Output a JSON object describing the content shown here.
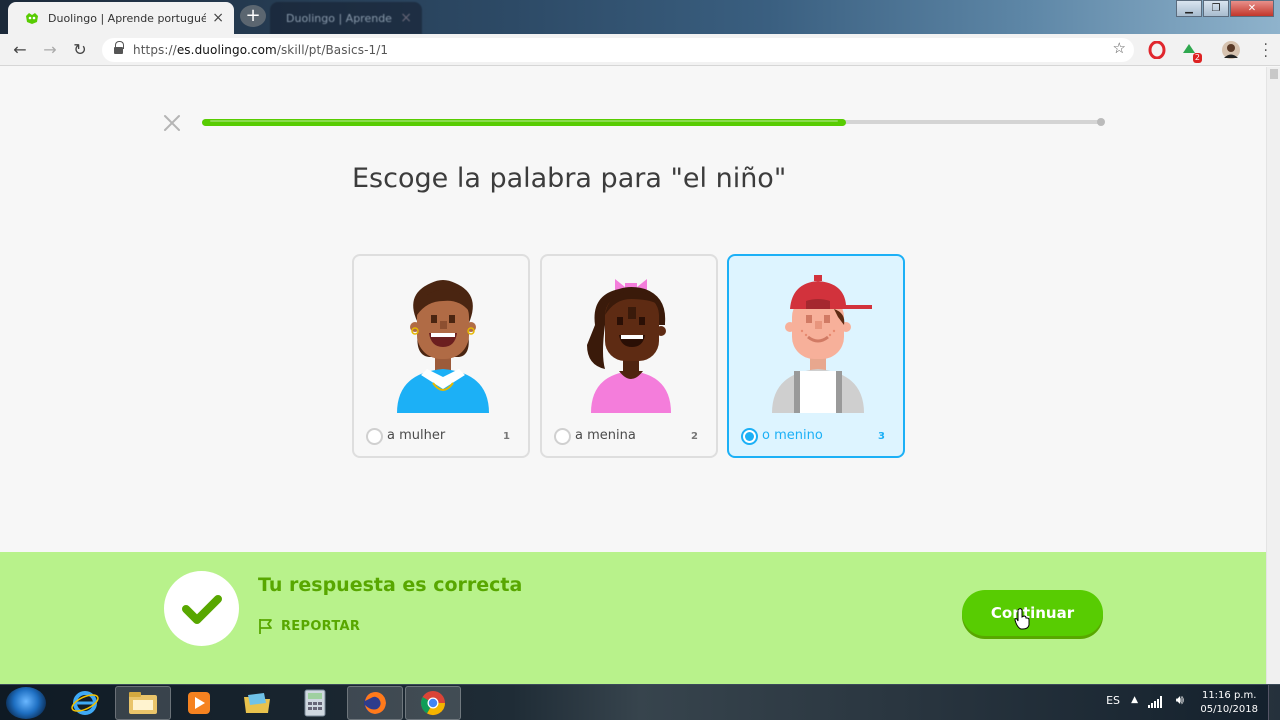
{
  "browser": {
    "tabs": [
      {
        "title": "Duolingo | Aprende portugués c",
        "close": "×"
      },
      {
        "title": "Duolingo | Aprende portugués c",
        "close": "×"
      }
    ],
    "new_tab": "+",
    "window_buttons": {
      "minimize": "▁",
      "maximize": "❐",
      "close": "✕"
    },
    "url_prefix": "https://",
    "url_host": "es.duolingo.com",
    "url_path": "/skill/pt/Basics-1/1",
    "bookmark_icon": "star-icon",
    "extension_badge": "2"
  },
  "lesson": {
    "progress_fraction": 0.715,
    "prompt": "Escoge la palabra para \"el niño\"",
    "choices": [
      {
        "label": "a mulher",
        "key": "1",
        "selected": false
      },
      {
        "label": "a menina",
        "key": "2",
        "selected": false
      },
      {
        "label": "o menino",
        "key": "3",
        "selected": true
      }
    ]
  },
  "feedback": {
    "title": "Tu respuesta es correcta",
    "report": "REPORTAR",
    "continue": "Continuar"
  },
  "taskbar": {
    "language": "ES",
    "time": "11:16 p.m.",
    "date": "05/10/2018"
  },
  "colors": {
    "accent_green": "#58cc02",
    "feedback_bg": "#b8f28b",
    "feedback_text": "#58a700",
    "selected_blue": "#1cb0f6"
  }
}
